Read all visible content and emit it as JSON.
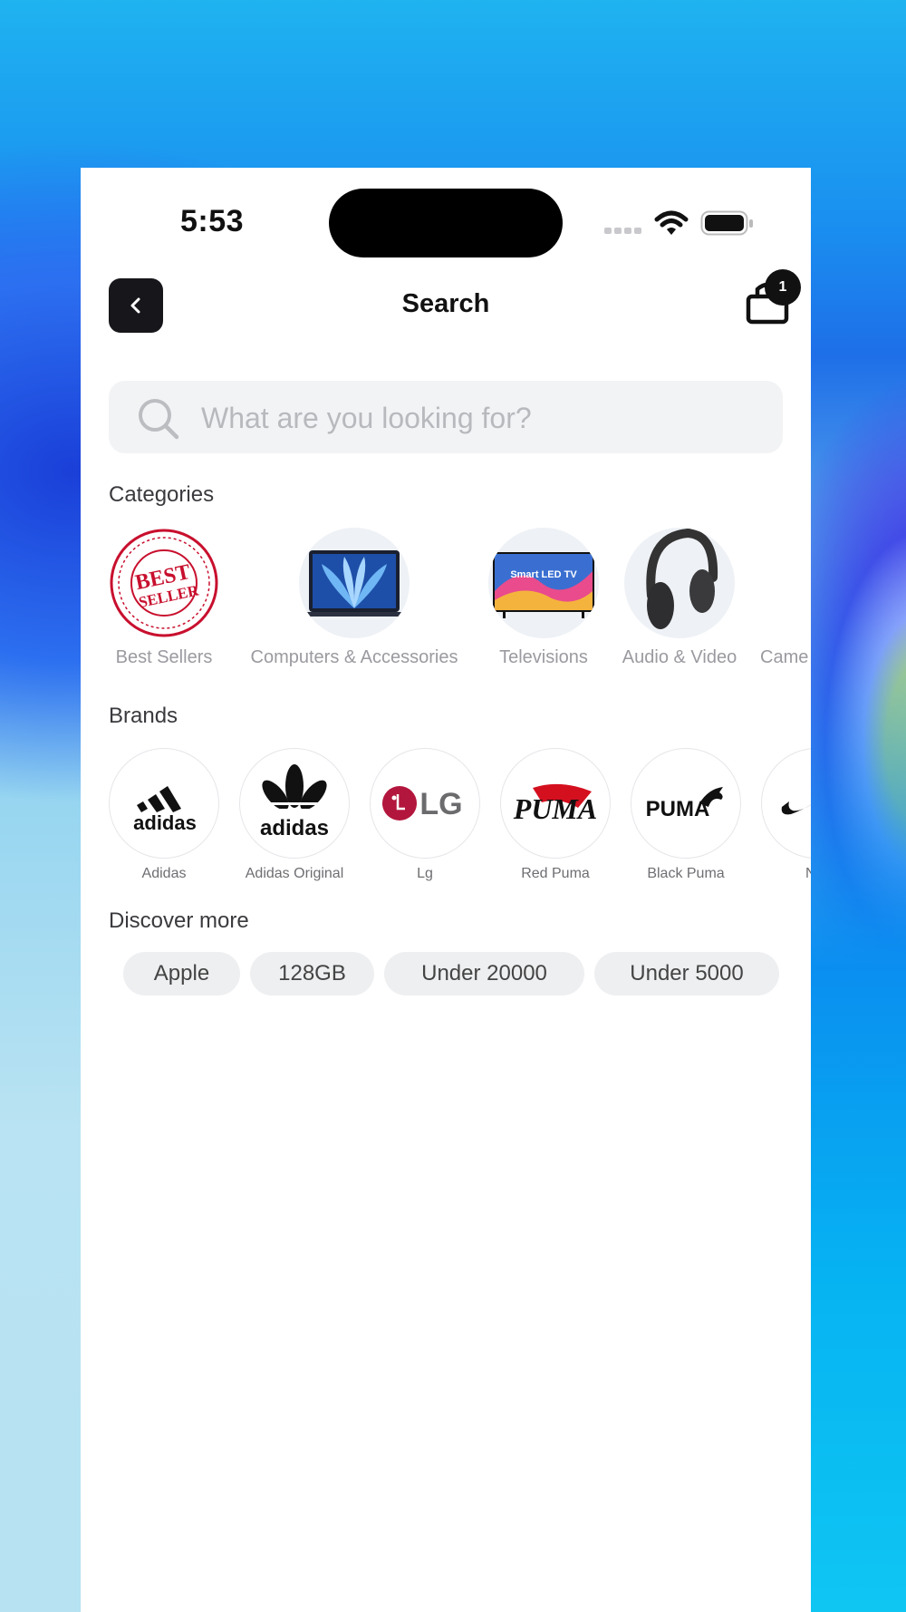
{
  "status_bar": {
    "time": "5:53"
  },
  "header": {
    "title": "Search",
    "cart_count": "1"
  },
  "search": {
    "placeholder": "What are you looking for?"
  },
  "categories": {
    "title": "Categories",
    "items": [
      {
        "label": "Best Sellers",
        "badge_text": [
          "BEST",
          "SELLER"
        ]
      },
      {
        "label": "Computers & Accessories"
      },
      {
        "label": "Televisions",
        "screen_text": "Smart LED TV"
      },
      {
        "label": "Audio & Video"
      },
      {
        "label": "Came"
      }
    ]
  },
  "brands": {
    "title": "Brands",
    "items": [
      {
        "label": "Adidas",
        "logo": "adidas"
      },
      {
        "label": "Adidas Original",
        "logo": "adidas"
      },
      {
        "label": "Lg",
        "logo": "LG"
      },
      {
        "label": "Red Puma",
        "logo": "PUMA"
      },
      {
        "label": "Black Puma",
        "logo": "PUMA"
      },
      {
        "label": "N"
      }
    ]
  },
  "discover": {
    "title": "Discover more",
    "chips": [
      "Apple",
      "128GB",
      "Under 20000",
      "Under 5000"
    ]
  },
  "colors": {
    "accent": "#17171b",
    "badge_red": "#c8102e",
    "chip_bg": "#eeeff1"
  }
}
